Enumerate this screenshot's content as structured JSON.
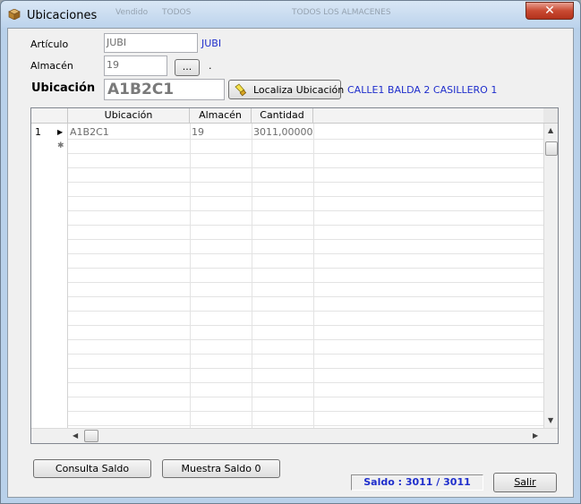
{
  "window": {
    "title": "Ubicaciones",
    "close_glyph": "✕",
    "bg_behind": [
      "Vendido",
      "TODOS",
      "TODOS LOS ALMACENES"
    ]
  },
  "form": {
    "articulo_label": "Artículo",
    "articulo_value": "JUBI",
    "articulo_desc": "JUBI",
    "almacen_label": "Almacén",
    "almacen_value": "19",
    "almacen_browse": "...",
    "almacen_desc": ".",
    "ubicacion_label": "Ubicación",
    "ubicacion_value": "A1B2C1",
    "localiza_label": "Localiza Ubicación",
    "ubicacion_desc": "CALLE1 BALDA 2 CASILLERO 1"
  },
  "grid": {
    "columns": [
      "Ubicación",
      "Almacén",
      "Cantidad"
    ],
    "rows": [
      {
        "num": "1",
        "marker": "▶",
        "ubicacion": "A1B2C1",
        "almacen": "19",
        "cantidad": "3011,000000"
      }
    ],
    "new_row_marker": "✱"
  },
  "footer": {
    "consulta_label": "Consulta Saldo",
    "muestra_label": "Muestra Saldo 0",
    "saldo_text": "Saldo :  3011  /  3011",
    "salir_label": "Salir"
  },
  "colors": {
    "accent_blue": "#1f2ecc",
    "close_red": "#c94a32"
  }
}
